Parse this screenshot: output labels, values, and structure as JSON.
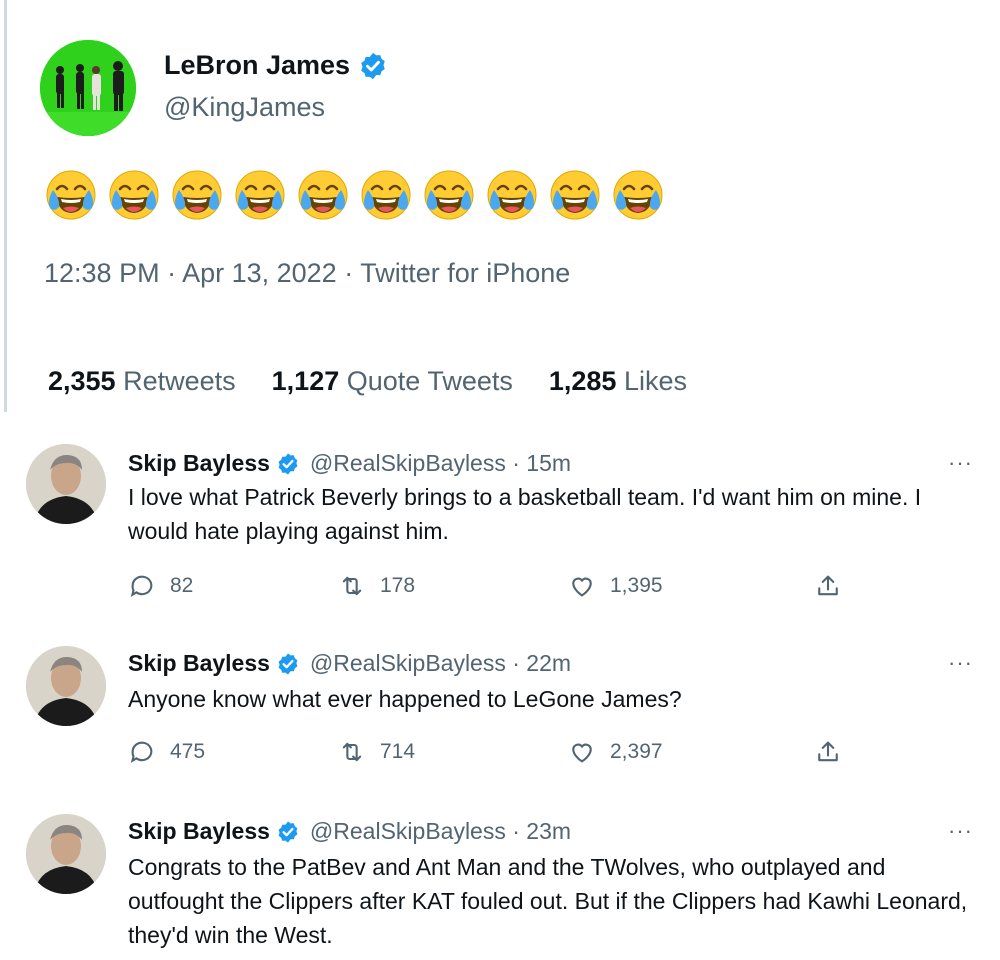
{
  "main_tweet": {
    "author_name": "LeBron James",
    "author_handle": "@KingJames",
    "emoji_name": "face-with-tears-of-joy",
    "emoji_count": 10,
    "meta": "12:38 PM · Apr 13, 2022 · Twitter for iPhone",
    "stats": [
      {
        "count": "2,355",
        "label": "Retweets"
      },
      {
        "count": "1,127",
        "label": "Quote Tweets"
      },
      {
        "count": "1,285",
        "label": "Likes"
      }
    ]
  },
  "replies": [
    {
      "name": "Skip Bayless",
      "handle": "@RealSkipBayless · 15m",
      "text": "I love what Patrick Beverly brings to a basketball team. I'd want him on mine. I would hate playing against him.",
      "comments": "82",
      "retweets": "178",
      "likes": "1,395",
      "more": "···"
    },
    {
      "name": "Skip Bayless",
      "handle": "@RealSkipBayless · 22m",
      "text": "Anyone know what ever happened to LeGone James?",
      "comments": "475",
      "retweets": "714",
      "likes": "2,397",
      "more": "···"
    },
    {
      "name": "Skip Bayless",
      "handle": "@RealSkipBayless · 23m",
      "text": "Congrats to the PatBev and Ant Man and the TWolves, who outplayed and outfought the Clippers after KAT fouled out. But if the Clippers had Kawhi Leonard, they'd win the West.",
      "more": "···"
    }
  ],
  "colors": {
    "verified": "#1d9bf0",
    "secondary_text": "#536471",
    "avatar_background": "#2fd11c"
  }
}
